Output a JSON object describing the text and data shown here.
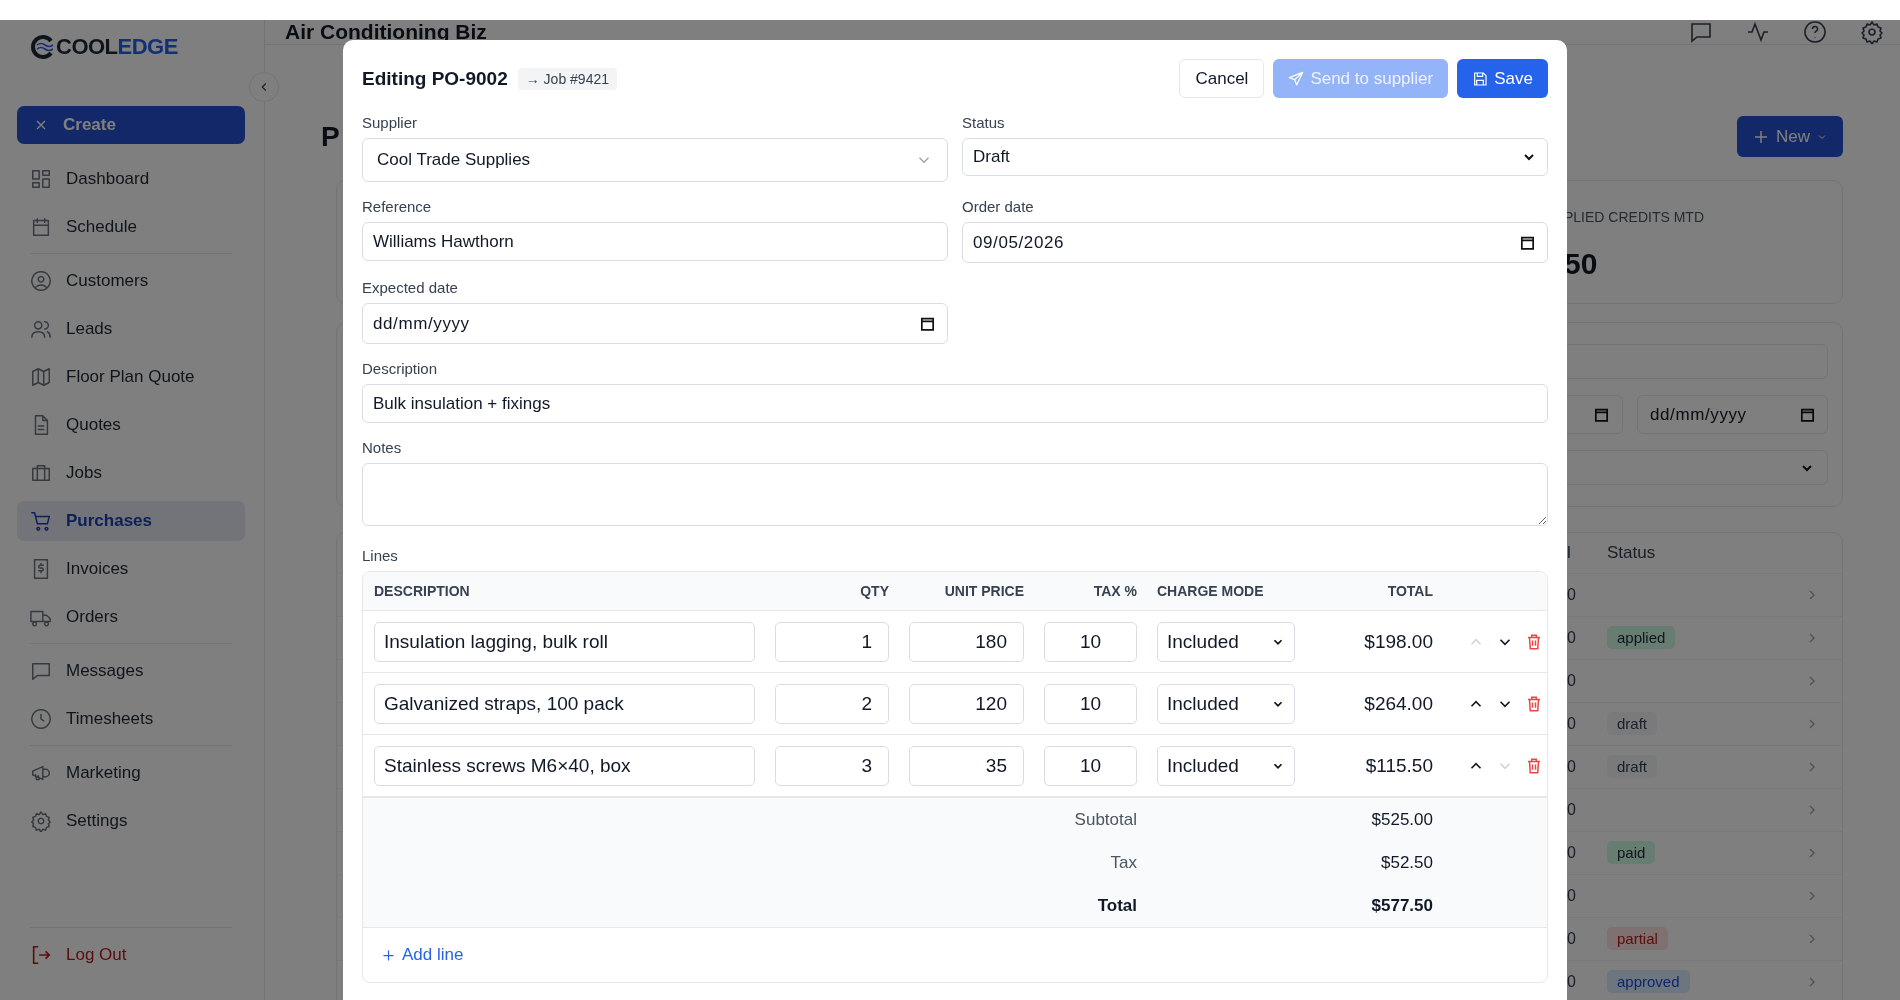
{
  "sidebar": {
    "brand": {
      "name": "COOL",
      "accent": "EDGE"
    },
    "create_button": "Create",
    "groups": [
      [
        {
          "label": "Dashboard",
          "selected": false
        },
        {
          "label": "Schedule",
          "selected": false
        }
      ],
      [
        {
          "label": "Customers",
          "selected": false
        },
        {
          "label": "Leads",
          "selected": false
        },
        {
          "label": "Floor Plan Quote",
          "selected": false
        },
        {
          "label": "Quotes",
          "selected": false
        },
        {
          "label": "Jobs",
          "selected": false
        },
        {
          "label": "Purchases",
          "selected": true
        },
        {
          "label": "Invoices",
          "selected": false
        },
        {
          "label": "Orders",
          "selected": false
        }
      ],
      [
        {
          "label": "Messages",
          "selected": false
        },
        {
          "label": "Timesheets",
          "selected": false
        }
      ],
      [
        {
          "label": "Marketing",
          "selected": false
        },
        {
          "label": "Settings",
          "selected": false
        }
      ]
    ],
    "logout": "Log Out"
  },
  "topbar": {
    "title": "Air Conditioning Biz"
  },
  "background_page": {
    "heading": "P",
    "new_button": "New",
    "stat_card": {
      "label": "PLIED CREDITS MTD",
      "value": "50"
    },
    "filters": {
      "end_date": {
        "placeholder": "dd/mm/yyyy"
      }
    },
    "table": {
      "columns": [
        "l",
        "Status"
      ],
      "rows": [
        {
          "column_1": "0"
        },
        {
          "column_1": "0",
          "status": {
            "label": "applied",
            "kind": "success"
          }
        },
        {
          "column_1": "0"
        },
        {
          "column_1": "0",
          "status": {
            "label": "draft",
            "kind": "neutral"
          }
        },
        {
          "column_1": "0",
          "status": {
            "label": "draft",
            "kind": "neutral"
          }
        },
        {
          "column_1": "0"
        },
        {
          "column_1": "0",
          "status": {
            "label": "paid",
            "kind": "success"
          }
        },
        {
          "column_1": "0"
        },
        {
          "column_1": "0",
          "status": {
            "label": "partial",
            "kind": "danger"
          }
        },
        {
          "column_1": "0",
          "status": {
            "label": "approved",
            "kind": "info"
          }
        }
      ]
    }
  },
  "modal": {
    "title": "Editing PO-9002",
    "job_badge": "→ Job #9421",
    "buttons": [
      {
        "label": "Cancel",
        "kind": "secondary",
        "disabled": false
      },
      {
        "label": "Send to supplier",
        "kind": "send",
        "disabled": true
      },
      {
        "label": "Save",
        "kind": "save",
        "disabled": false
      }
    ],
    "supplier": {
      "label": "Supplier",
      "value": "Cool Trade Supplies"
    },
    "status": {
      "label": "Status",
      "value": "Draft"
    },
    "reference": {
      "label": "Reference",
      "value": "Williams Hawthorn"
    },
    "order_date": {
      "label": "Order date",
      "value": "09/05/2026"
    },
    "expected_date": {
      "label": "Expected date",
      "placeholder": "dd/mm/yyyy"
    },
    "description": {
      "label": "Description",
      "value": "Bulk insulation + fixings"
    },
    "notes": {
      "label": "Notes"
    },
    "lines": {
      "label": "Lines",
      "columns": [
        "DESCRIPTION",
        "QTY",
        "UNIT PRICE",
        "TAX %",
        "CHARGE MODE",
        "TOTAL"
      ],
      "rows": [
        {
          "description": "Insulation lagging, bulk roll",
          "qty": "1",
          "unit_price": "180",
          "tax": "10",
          "charge_mode": "Included",
          "total": "$198.00",
          "up_disabled": true,
          "down_disabled": false
        },
        {
          "description": "Galvanized straps, 100 pack",
          "qty": "2",
          "unit_price": "120",
          "tax": "10",
          "charge_mode": "Included",
          "total": "$264.00",
          "up_disabled": false,
          "down_disabled": false
        },
        {
          "description": "Stainless screws M6×40, box",
          "qty": "3",
          "unit_price": "35",
          "tax": "10",
          "charge_mode": "Included",
          "total": "$115.50",
          "up_disabled": false,
          "down_disabled": true
        }
      ],
      "totals": [
        {
          "label": "Subtotal",
          "value": "$525.00",
          "kind": "normal"
        },
        {
          "label": "Tax",
          "value": "$52.50",
          "kind": "normal"
        },
        {
          "label": "Total",
          "value": "$577.50",
          "kind": "grand"
        }
      ],
      "add_line": "Add line"
    }
  }
}
